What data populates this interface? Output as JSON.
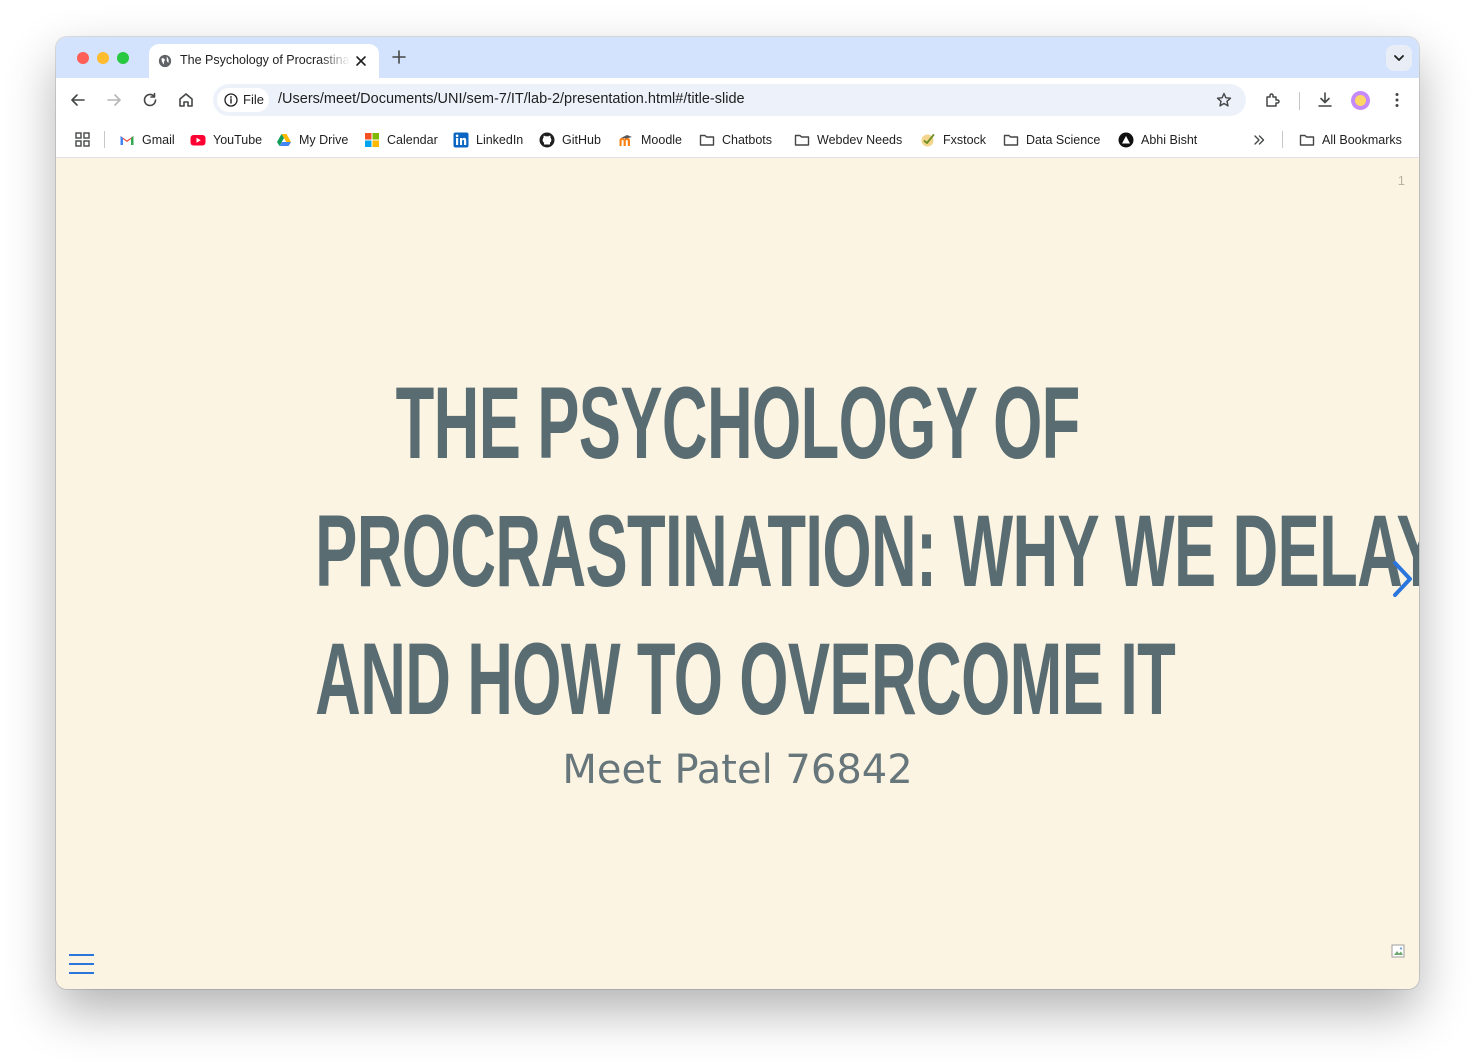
{
  "browser": {
    "tab_title": "The Psychology of Procrastination: Why We Delay and How to Overcome It",
    "url_chip": "File",
    "url": "/Users/meet/Documents/UNI/sem-7/IT/lab-2/presentation.html#/title-slide"
  },
  "bookmarks": [
    {
      "label": "Gmail",
      "icon": "gmail-icon"
    },
    {
      "label": "YouTube",
      "icon": "youtube-icon"
    },
    {
      "label": "My Drive",
      "icon": "drive-icon"
    },
    {
      "label": "Calendar",
      "icon": "calendar-icon"
    },
    {
      "label": "LinkedIn",
      "icon": "linkedin-icon"
    },
    {
      "label": "GitHub",
      "icon": "github-icon"
    },
    {
      "label": "Moodle",
      "icon": "moodle-icon"
    },
    {
      "label": "Chatbots",
      "icon": "folder-icon"
    },
    {
      "label": "Webdev Needs",
      "icon": "folder-icon"
    },
    {
      "label": "Fxstock",
      "icon": "fxstock-icon"
    },
    {
      "label": "Data Science",
      "icon": "folder-icon"
    },
    {
      "label": "Abhi Bisht",
      "icon": "abhi-icon"
    }
  ],
  "all_bookmarks": "All Bookmarks",
  "slide": {
    "number": "1",
    "title_lines": [
      "THE PSYCHOLOGY OF",
      "PROCRASTINATION: WHY WE DELAY",
      "AND HOW TO OVERCOME IT"
    ],
    "subtitle": "Meet Patel 76842"
  },
  "colors": {
    "slide_background": "#fcf4e3",
    "title_text": "#586c72",
    "accent": "#2a76dd",
    "tab_strip": "#d3e3fd"
  }
}
